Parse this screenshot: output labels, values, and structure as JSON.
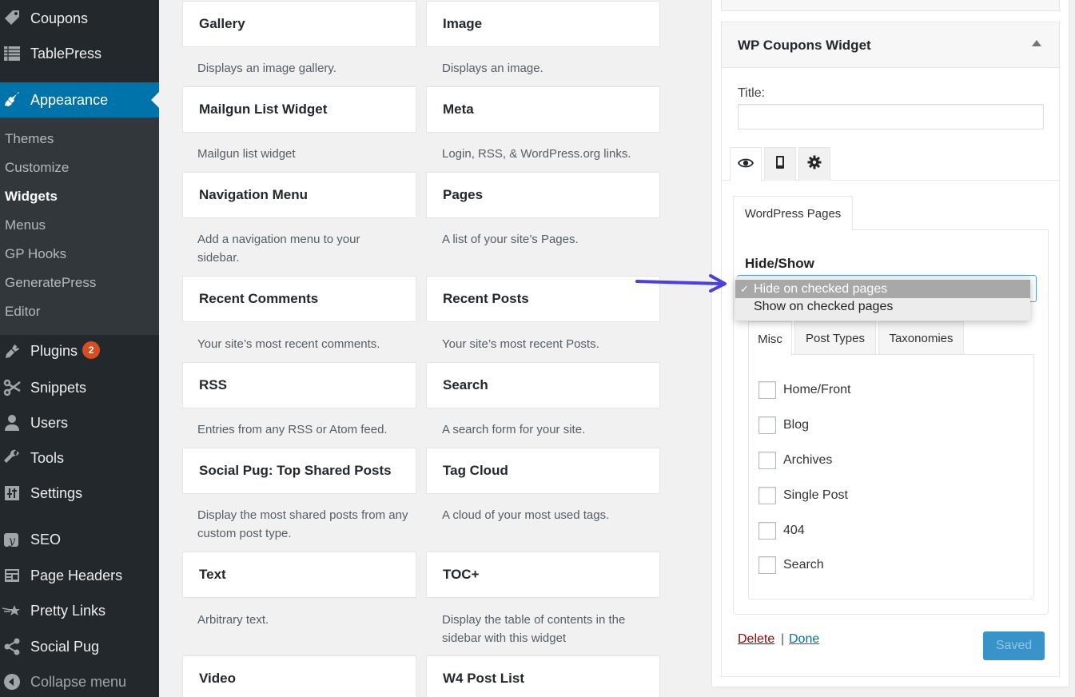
{
  "sidebar": {
    "menu_top": [
      {
        "label": "Coupons",
        "icon": "tag-icon"
      },
      {
        "label": "TablePress",
        "icon": "table-icon"
      }
    ],
    "active": {
      "label": "Appearance",
      "icon": "paintbrush-icon"
    },
    "submenu": [
      {
        "label": "Themes"
      },
      {
        "label": "Customize"
      },
      {
        "label": "Widgets",
        "current": true
      },
      {
        "label": "Menus"
      },
      {
        "label": "GP Hooks"
      },
      {
        "label": "GeneratePress"
      },
      {
        "label": "Editor"
      }
    ],
    "menu_bottom": [
      {
        "label": "Plugins",
        "icon": "plug-icon",
        "badge": "2"
      },
      {
        "label": "Snippets",
        "icon": "scissors-icon"
      },
      {
        "label": "Users",
        "icon": "user-icon"
      },
      {
        "label": "Tools",
        "icon": "wrench-icon"
      },
      {
        "label": "Settings",
        "icon": "sliders-icon"
      },
      {
        "label": "SEO",
        "icon": "yoast-icon"
      },
      {
        "label": "Page Headers",
        "icon": "layout-icon"
      },
      {
        "label": "Pretty Links",
        "icon": "star-link-icon"
      },
      {
        "label": "Social Pug",
        "icon": "share-icon"
      }
    ],
    "collapse_label": "Collapse menu",
    "badge_color": "#d54e21",
    "accent_color": "#0073aa"
  },
  "widgets": [
    {
      "title": "Gallery",
      "desc": "Displays an image gallery."
    },
    {
      "title": "Image",
      "desc": "Displays an image."
    },
    {
      "title": "Mailgun List Widget",
      "desc": "Mailgun list widget"
    },
    {
      "title": "Meta",
      "desc": "Login, RSS, & WordPress.org links."
    },
    {
      "title": "Navigation Menu",
      "desc": "Add a navigation menu to your sidebar."
    },
    {
      "title": "Pages",
      "desc": "A list of your site’s Pages."
    },
    {
      "title": "Recent Comments",
      "desc": "Your site’s most recent comments."
    },
    {
      "title": "Recent Posts",
      "desc": "Your site’s most recent Posts."
    },
    {
      "title": "RSS",
      "desc": "Entries from any RSS or Atom feed."
    },
    {
      "title": "Search",
      "desc": "A search form for your site."
    },
    {
      "title": "Social Pug: Top Shared Posts",
      "desc": "Display the most shared posts from any custom post type."
    },
    {
      "title": "Tag Cloud",
      "desc": "A cloud of your most used tags."
    },
    {
      "title": "Text",
      "desc": "Arbitrary text."
    },
    {
      "title": "TOC+",
      "desc": "Display the table of contents in the sidebar with this widget"
    },
    {
      "title": "Video",
      "desc": ""
    },
    {
      "title": "W4 Post List",
      "desc": ""
    }
  ],
  "panel": {
    "widget_title": "WP Coupons Widget",
    "title_label": "Title:",
    "title_value": "",
    "icon_tabs": [
      "eye-icon",
      "mobile-icon",
      "gear-icon"
    ],
    "pages_tab": "WordPress Pages",
    "hide_show_label": "Hide/Show",
    "options": [
      "Hide on checked pages",
      "Show on checked pages"
    ],
    "selected_option": "Hide on checked pages",
    "sub_tabs": [
      "Misc",
      "Post Types",
      "Taxonomies"
    ],
    "checkboxes": [
      {
        "label": "Home/Front",
        "checked": false
      },
      {
        "label": "Blog",
        "checked": false
      },
      {
        "label": "Archives",
        "checked": false
      },
      {
        "label": "Single Post",
        "checked": false
      },
      {
        "label": "404",
        "checked": false
      },
      {
        "label": "Search",
        "checked": false
      }
    ],
    "delete_label": "Delete",
    "separator": "|",
    "done_label": "Done",
    "saved_label": "Saved",
    "arrow_color": "#4a3fe0"
  }
}
